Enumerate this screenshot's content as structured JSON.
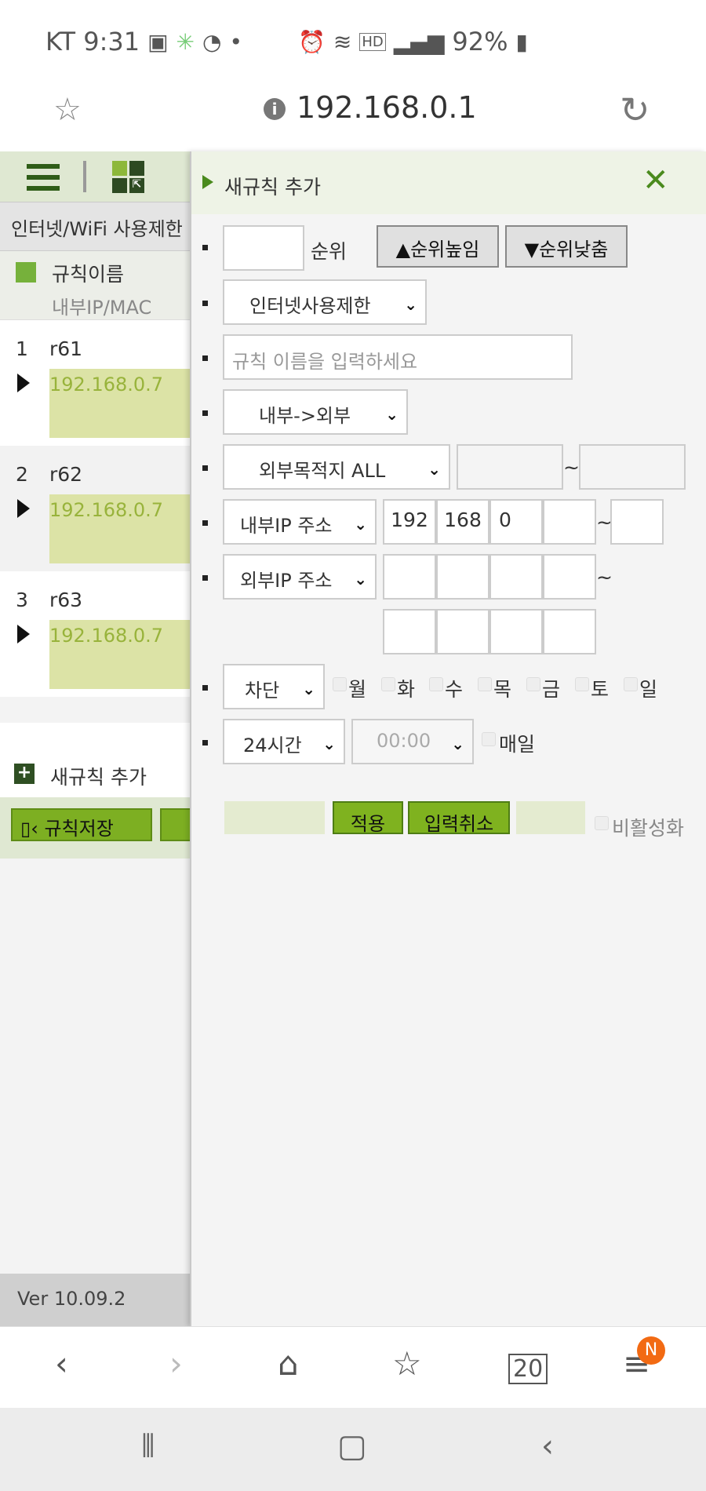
{
  "status_bar": {
    "carrier_time": "KT 9:31",
    "battery": "92%"
  },
  "url_bar": {
    "url": "192.168.0.1"
  },
  "left_panel": {
    "filter_label": "인터넷/WiFi 사용제한",
    "header_name": "규칙이름",
    "header_sub": "내부IP/MAC",
    "rules": [
      {
        "num": "1",
        "name": "r61",
        "ip": "192.168.0.7"
      },
      {
        "num": "2",
        "name": "r62",
        "ip": "192.168.0.7"
      },
      {
        "num": "3",
        "name": "r63",
        "ip": "192.168.0.7"
      }
    ],
    "add_rule_label": "새규칙 추가",
    "save_rules_label": "규칙저장",
    "version": "Ver 10.09.2"
  },
  "right_panel": {
    "title": "새규칙 추가",
    "order_label": "순위",
    "order_up_label": "▲순위높임",
    "order_down_label": "▼순위낮춤",
    "type_select": "인터넷사용제한",
    "rule_name_placeholder": "규칙 이름을 입력하세요",
    "direction_select": "내부->외부",
    "dest_select": "외부목적지 ALL",
    "tilde": "~",
    "internal_ip_select": "내부IP 주소",
    "internal_ip": [
      "192",
      "168",
      "0",
      ""
    ],
    "external_ip_select": "외부IP 주소",
    "action_select": "차단",
    "days": [
      "월",
      "화",
      "수",
      "목",
      "금",
      "토",
      "일"
    ],
    "time_select": "24시간",
    "time_value": "00:00",
    "everyday_label": "매일",
    "apply_label": "적용",
    "cancel_label": "입력취소",
    "disable_label": "비활성화"
  }
}
